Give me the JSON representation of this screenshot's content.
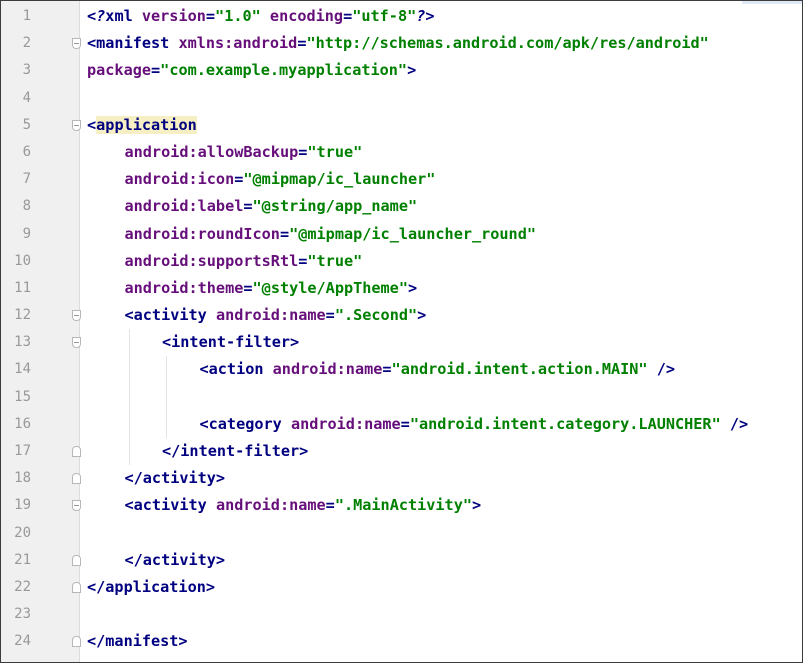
{
  "lines": [
    {
      "n": "1",
      "fold": "",
      "indent": 0,
      "t": [
        [
          "pi",
          "<?"
        ],
        [
          "k",
          "xml "
        ],
        [
          "a",
          "version"
        ],
        [
          "k",
          "="
        ],
        [
          "v",
          "\"1.0\""
        ],
        [
          "k",
          " "
        ],
        [
          "a",
          "encoding"
        ],
        [
          "k",
          "="
        ],
        [
          "v",
          "\"utf-8\""
        ],
        [
          "pi",
          "?>"
        ]
      ]
    },
    {
      "n": "2",
      "fold": "open",
      "indent": 0,
      "t": [
        [
          "k",
          "<manifest "
        ],
        [
          "a",
          "xmlns:android"
        ],
        [
          "k",
          "="
        ],
        [
          "v",
          "\"http://schemas.android.com/apk/res/android\""
        ]
      ]
    },
    {
      "n": "3",
      "fold": "",
      "indent": 0,
      "t": [
        [
          "a",
          "package"
        ],
        [
          "k",
          "="
        ],
        [
          "v",
          "\"com.example.myapplication\""
        ],
        [
          "k",
          ">"
        ]
      ]
    },
    {
      "n": "4",
      "fold": "",
      "indent": 0,
      "t": []
    },
    {
      "n": "5",
      "fold": "open",
      "indent": 0,
      "t": [
        [
          "k",
          "<"
        ],
        [
          "k hl",
          "application"
        ]
      ]
    },
    {
      "n": "6",
      "fold": "",
      "indent": 1,
      "t": [
        [
          "a",
          "android:allowBackup"
        ],
        [
          "k",
          "="
        ],
        [
          "v",
          "\"true\""
        ]
      ]
    },
    {
      "n": "7",
      "fold": "",
      "indent": 1,
      "t": [
        [
          "a",
          "android:icon"
        ],
        [
          "k",
          "="
        ],
        [
          "v",
          "\"@mipmap/ic_launcher\""
        ]
      ]
    },
    {
      "n": "8",
      "fold": "",
      "indent": 1,
      "t": [
        [
          "a",
          "android:label"
        ],
        [
          "k",
          "="
        ],
        [
          "v",
          "\"@string/app_name\""
        ]
      ]
    },
    {
      "n": "9",
      "fold": "",
      "indent": 1,
      "t": [
        [
          "a",
          "android:roundIcon"
        ],
        [
          "k",
          "="
        ],
        [
          "v",
          "\"@mipmap/ic_launcher_round\""
        ]
      ]
    },
    {
      "n": "10",
      "fold": "",
      "indent": 1,
      "t": [
        [
          "a",
          "android:supportsRtl"
        ],
        [
          "k",
          "="
        ],
        [
          "v",
          "\"true\""
        ]
      ]
    },
    {
      "n": "11",
      "fold": "",
      "indent": 1,
      "t": [
        [
          "a",
          "android:theme"
        ],
        [
          "k",
          "="
        ],
        [
          "v",
          "\"@style/AppTheme\""
        ],
        [
          "k",
          ">"
        ]
      ]
    },
    {
      "n": "12",
      "fold": "open",
      "indent": 1,
      "t": [
        [
          "k",
          "<activity "
        ],
        [
          "a",
          "android:name"
        ],
        [
          "k",
          "="
        ],
        [
          "v",
          "\".Second\""
        ],
        [
          "k",
          ">"
        ]
      ]
    },
    {
      "n": "13",
      "fold": "open",
      "indent": 2,
      "t": [
        [
          "k",
          "<intent-filter>"
        ]
      ]
    },
    {
      "n": "14",
      "fold": "",
      "indent": 3,
      "t": [
        [
          "k",
          "<action "
        ],
        [
          "a",
          "android:name"
        ],
        [
          "k",
          "="
        ],
        [
          "v",
          "\"android.intent.action.MAIN\""
        ],
        [
          "k",
          " />"
        ]
      ]
    },
    {
      "n": "15",
      "fold": "",
      "indent": 3,
      "t": []
    },
    {
      "n": "16",
      "fold": "",
      "indent": 3,
      "t": [
        [
          "k",
          "<category "
        ],
        [
          "a",
          "android:name"
        ],
        [
          "k",
          "="
        ],
        [
          "v",
          "\"android.intent.category.LAUNCHER\""
        ],
        [
          "k",
          " />"
        ]
      ]
    },
    {
      "n": "17",
      "fold": "close",
      "indent": 2,
      "t": [
        [
          "k",
          "</intent-filter>"
        ]
      ]
    },
    {
      "n": "18",
      "fold": "close",
      "indent": 1,
      "t": [
        [
          "k",
          "</activity>"
        ]
      ]
    },
    {
      "n": "19",
      "fold": "open",
      "indent": 1,
      "t": [
        [
          "k",
          "<activity "
        ],
        [
          "a",
          "android:name"
        ],
        [
          "k",
          "="
        ],
        [
          "v",
          "\".MainActivity\""
        ],
        [
          "k",
          ">"
        ]
      ]
    },
    {
      "n": "20",
      "fold": "",
      "indent": 1,
      "t": []
    },
    {
      "n": "21",
      "fold": "close",
      "indent": 1,
      "t": [
        [
          "k",
          "</activity>"
        ]
      ]
    },
    {
      "n": "22",
      "fold": "close",
      "indent": 0,
      "t": [
        [
          "k",
          "</application>"
        ]
      ]
    },
    {
      "n": "23",
      "fold": "",
      "indent": 0,
      "t": []
    },
    {
      "n": "24",
      "fold": "close",
      "indent": 0,
      "t": [
        [
          "k",
          "</manifest>"
        ]
      ]
    }
  ]
}
